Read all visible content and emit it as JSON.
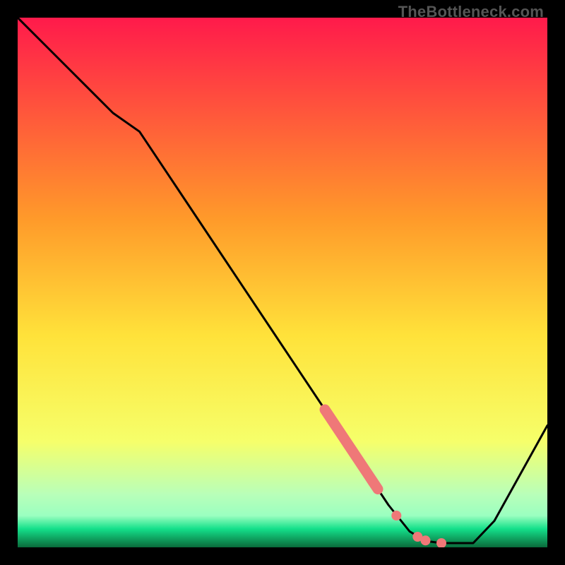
{
  "watermark": "TheBottleneck.com",
  "colors": {
    "frame": "#000000",
    "curve": "#000000",
    "highlight": "#ef7878",
    "gradient_top": "#ff1a4b",
    "gradient_mid_upper": "#ff9a2a",
    "gradient_mid": "#ffe23a",
    "gradient_mid_lower": "#f6ff6a",
    "gradient_pale": "#b9ffb9",
    "gradient_green": "#14e08a",
    "gradient_bottom": "#0a6a3a"
  },
  "chart_data": {
    "type": "line",
    "title": "",
    "xlabel": "",
    "ylabel": "",
    "xlim": [
      0,
      100
    ],
    "ylim": [
      0,
      100
    ],
    "curve": [
      {
        "x": 0,
        "y": 100
      },
      {
        "x": 5,
        "y": 95
      },
      {
        "x": 10,
        "y": 90
      },
      {
        "x": 18,
        "y": 82
      },
      {
        "x": 23,
        "y": 78.5
      },
      {
        "x": 30,
        "y": 68
      },
      {
        "x": 40,
        "y": 53
      },
      {
        "x": 50,
        "y": 38
      },
      {
        "x": 58,
        "y": 26
      },
      {
        "x": 62,
        "y": 20
      },
      {
        "x": 66,
        "y": 14
      },
      {
        "x": 70,
        "y": 8
      },
      {
        "x": 74,
        "y": 3
      },
      {
        "x": 77,
        "y": 1.2
      },
      {
        "x": 80,
        "y": 0.8
      },
      {
        "x": 84,
        "y": 0.8
      },
      {
        "x": 86,
        "y": 0.8
      },
      {
        "x": 90,
        "y": 5
      },
      {
        "x": 95,
        "y": 14
      },
      {
        "x": 100,
        "y": 23
      }
    ],
    "highlight_segment": [
      {
        "x": 58,
        "y": 26
      },
      {
        "x": 60,
        "y": 23
      },
      {
        "x": 62,
        "y": 20
      },
      {
        "x": 64,
        "y": 17
      },
      {
        "x": 66,
        "y": 14
      },
      {
        "x": 67,
        "y": 12.5
      },
      {
        "x": 68,
        "y": 11
      }
    ],
    "highlight_dots": [
      {
        "x": 71.5,
        "y": 6.0
      },
      {
        "x": 75.5,
        "y": 2.0
      },
      {
        "x": 77.0,
        "y": 1.3
      },
      {
        "x": 80.0,
        "y": 0.8
      }
    ]
  }
}
